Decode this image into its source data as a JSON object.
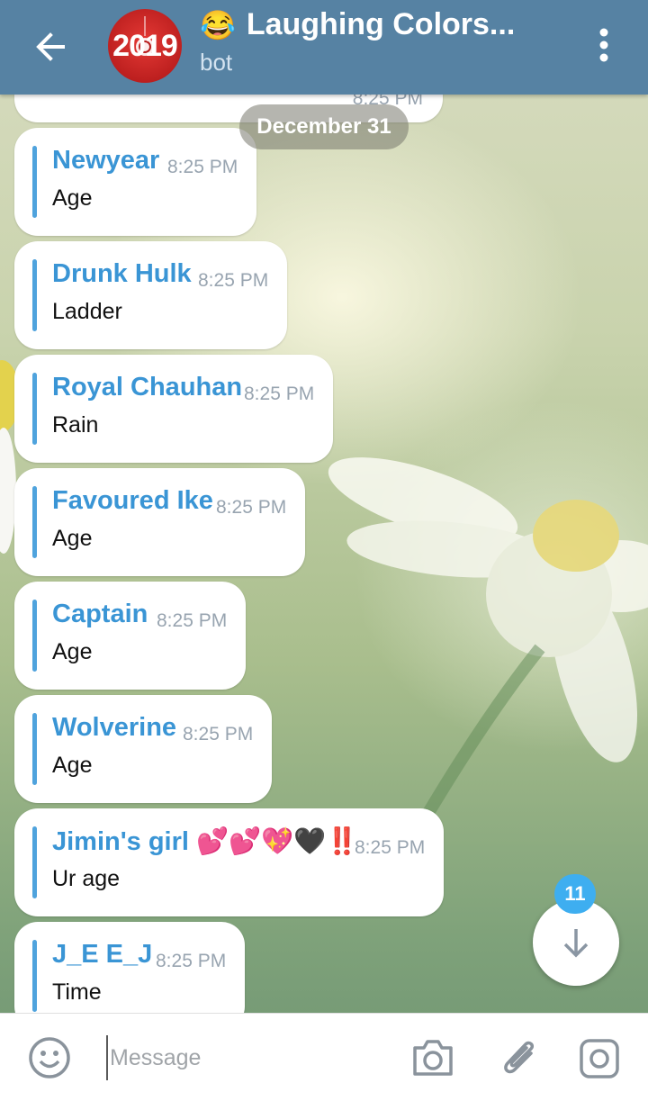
{
  "header": {
    "back_icon": "arrow-back-icon",
    "avatar_text": "2019",
    "title_emoji": "😂",
    "title": "Laughing Colors...",
    "subtitle": "bot",
    "menu_icon": "more-vert-icon"
  },
  "date_separator": "December 31",
  "partial_message_time": "8:25 PM",
  "messages": [
    {
      "sender": "Newyear",
      "time": "8:25 PM",
      "text": "Age"
    },
    {
      "sender": "Drunk Hulk",
      "time": "8:25 PM",
      "text": "Ladder"
    },
    {
      "sender": "Royal Chauhan",
      "time": "8:25 PM",
      "text": "Rain"
    },
    {
      "sender": "Favoured Ike",
      "time": "8:25 PM",
      "text": "Age"
    },
    {
      "sender": "Captain",
      "time": "8:25 PM",
      "text": "Age"
    },
    {
      "sender": "Wolverine",
      "time": "8:25 PM",
      "text": "Age"
    },
    {
      "sender": "Jimin's girl 💕💕💖🖤‼️",
      "time": "8:25 PM",
      "text": "Ur age"
    },
    {
      "sender": "J_E E_J",
      "time": "8:25 PM",
      "text": "Time"
    }
  ],
  "scroll_down": {
    "unread_count": "11",
    "icon": "arrow-down-icon"
  },
  "input": {
    "placeholder": "Message",
    "emoji_icon": "emoji-smile-icon",
    "camera_icon": "camera-icon",
    "attach_icon": "paperclip-icon",
    "instagram_icon": "instagram-icon"
  },
  "colors": {
    "header": "#5682a3",
    "sender_name": "#3a95d5",
    "quote_bar": "#4fa3dd",
    "badge": "#3eaef0"
  }
}
